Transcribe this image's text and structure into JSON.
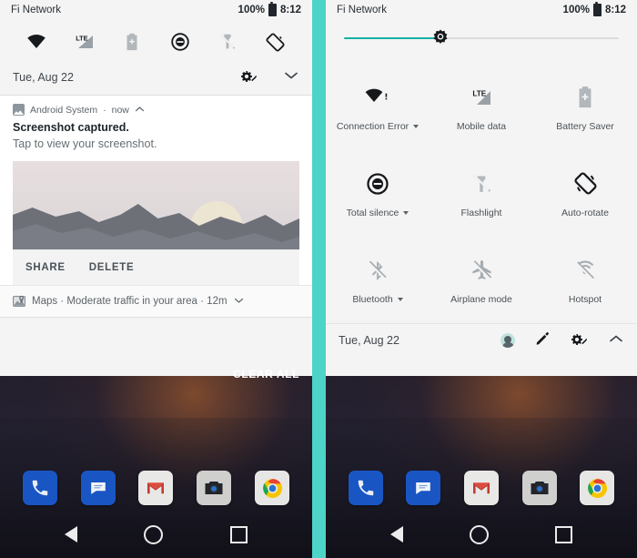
{
  "statusbar": {
    "carrier": "Fi Network",
    "battery_percent": "100%",
    "battery_icon": "battery-full-icon",
    "time": "8:12"
  },
  "left_panel": {
    "quick_icons": [
      {
        "name": "wifi-icon",
        "label": "Wi-Fi"
      },
      {
        "name": "lte-signal-icon",
        "label": "LTE"
      },
      {
        "name": "battery-saver-icon",
        "label": "Battery Saver"
      },
      {
        "name": "do-not-disturb-icon",
        "label": "Total silence"
      },
      {
        "name": "flashlight-off-icon",
        "label": "Flashlight"
      },
      {
        "name": "auto-rotate-icon",
        "label": "Auto-rotate"
      }
    ],
    "date": "Tue, Aug 22",
    "settings_icon": "settings-gear-icon",
    "expand_icon": "chevron-down-icon",
    "notifications": [
      {
        "app": "Android System",
        "time": "now",
        "collapse_icon": "chevron-up-icon",
        "title": "Screenshot captured.",
        "body": "Tap to view your screenshot.",
        "thumbnail": "screenshot-preview-image",
        "actions": [
          "SHARE",
          "DELETE"
        ]
      },
      {
        "app": "Maps",
        "app_icon": "maps-icon",
        "summary": "Moderate traffic in your area",
        "time": "12m",
        "expand_icon": "chevron-down-icon",
        "text": "Maps · Moderate traffic in your area · 12m"
      }
    ],
    "clear_all": "CLEAR ALL"
  },
  "right_panel": {
    "brightness": {
      "name": "brightness-slider",
      "value_percent": 35,
      "thumb_icon": "brightness-icon",
      "fill_color": "#13b0a5",
      "track_color": "#dcdcdc"
    },
    "tiles": [
      {
        "label": "Connection Error",
        "icon": "wifi-error-icon",
        "has_caret": true
      },
      {
        "label": "Mobile data",
        "icon": "lte-signal-icon",
        "has_caret": false
      },
      {
        "label": "Battery Saver",
        "icon": "battery-saver-icon",
        "has_caret": false
      },
      {
        "label": "Total silence",
        "icon": "do-not-disturb-icon",
        "has_caret": true
      },
      {
        "label": "Flashlight",
        "icon": "flashlight-off-icon",
        "has_caret": false
      },
      {
        "label": "Auto-rotate",
        "icon": "auto-rotate-icon",
        "has_caret": false
      },
      {
        "label": "Bluetooth",
        "icon": "bluetooth-off-icon",
        "has_caret": true
      },
      {
        "label": "Airplane mode",
        "icon": "airplane-off-icon",
        "has_caret": false
      },
      {
        "label": "Hotspot",
        "icon": "hotspot-off-icon",
        "has_caret": false
      }
    ],
    "footer": {
      "date": "Tue, Aug 22",
      "avatar": "user-avatar",
      "edit_icon": "pencil-edit-icon",
      "settings_icon": "settings-gear-icon",
      "collapse_icon": "chevron-up-icon"
    }
  },
  "home": {
    "drawer_handle_icon": "chevron-up-icon",
    "dock_apps": [
      {
        "name": "phone-app-icon",
        "label": "Phone"
      },
      {
        "name": "messages-app-icon",
        "label": "Messages"
      },
      {
        "name": "gmail-app-icon",
        "label": "Gmail"
      },
      {
        "name": "camera-app-icon",
        "label": "Camera"
      },
      {
        "name": "chrome-app-icon",
        "label": "Chrome"
      }
    ],
    "nav": [
      {
        "name": "nav-back-button",
        "label": "Back"
      },
      {
        "name": "nav-home-button",
        "label": "Home"
      },
      {
        "name": "nav-recents-button",
        "label": "Recents"
      }
    ]
  },
  "colors": {
    "accent_teal": "#4ed3c8",
    "slider_fill": "#13b0a5",
    "panel_bg": "#f4f4f4",
    "card_bg": "#ffffff"
  }
}
